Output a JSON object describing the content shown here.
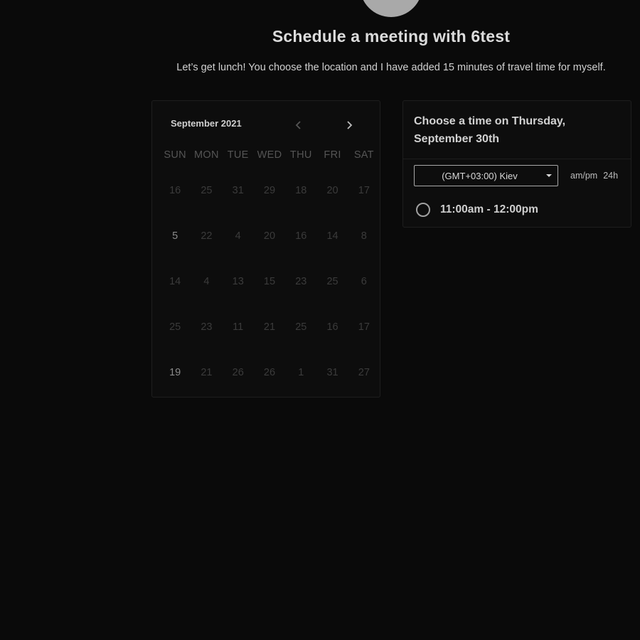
{
  "header": {
    "title": "Schedule a meeting with 6test",
    "description": "Let’s get lunch! You choose the location and I have added 15 minutes of travel time for myself."
  },
  "calendar": {
    "month": "September 2021",
    "prev_icon": "chevron-left-icon",
    "next_icon": "chevron-right-icon",
    "weekdays": [
      "SUN",
      "MON",
      "TUE",
      "WED",
      "THU",
      "FRI",
      "SAT"
    ],
    "weeks": [
      [
        "16",
        "25",
        "31",
        "29",
        "18",
        "20",
        "17"
      ],
      [
        "5",
        "22",
        "4",
        "20",
        "16",
        "14",
        "8"
      ],
      [
        "14",
        "4",
        "13",
        "15",
        "23",
        "25",
        "6"
      ],
      [
        "25",
        "23",
        "11",
        "21",
        "25",
        "16",
        "17"
      ],
      [
        "19",
        "21",
        "26",
        "26",
        "1",
        "31",
        "27"
      ]
    ]
  },
  "time_panel": {
    "heading_line1": "Choose a time on Thursday,",
    "heading_line2": "September 30th",
    "timezone": "(GMT+03:00) Kiev",
    "format_12h": "am/pm",
    "format_24h": "24h",
    "slots": [
      "11:00am - 12:00pm"
    ]
  },
  "colors": {
    "background": "#0a0a0a",
    "card": "#0d0d0d",
    "border": "#1e1e1e",
    "text": "#d8d8d8",
    "muted_day": "#3b3b3b"
  }
}
